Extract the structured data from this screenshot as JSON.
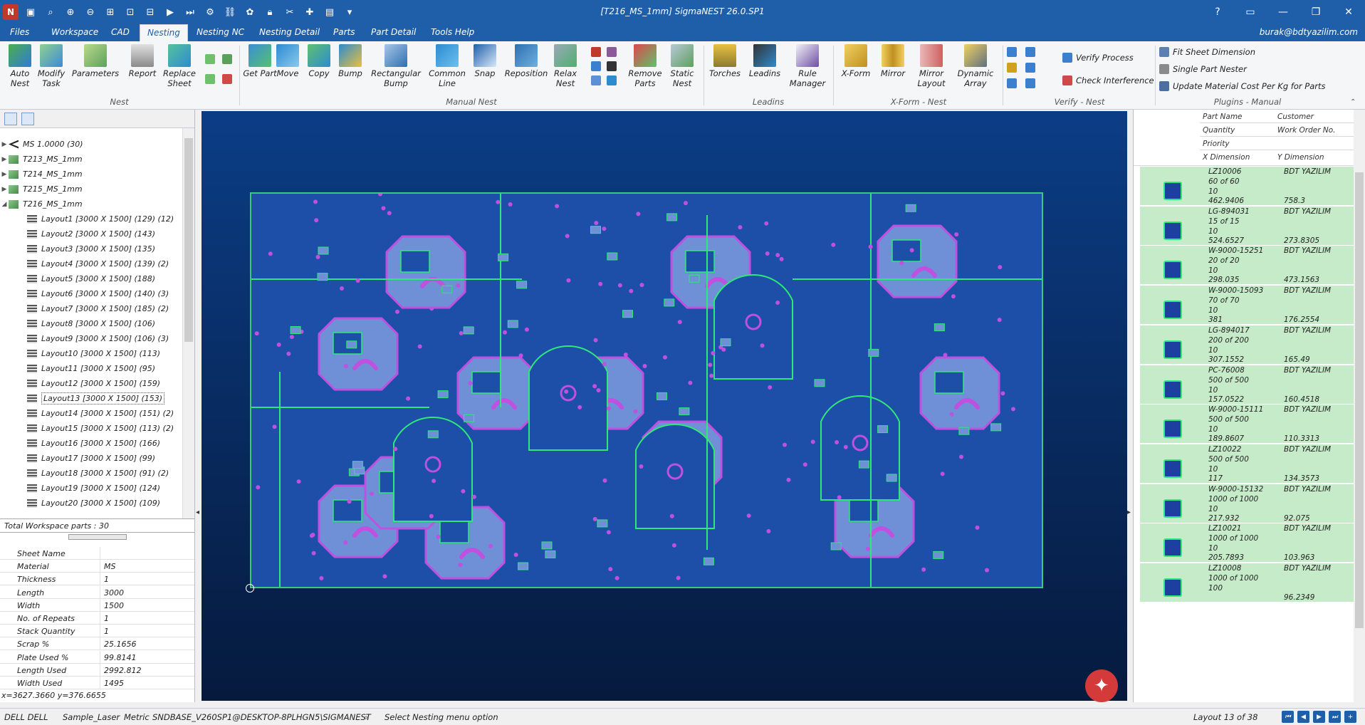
{
  "window": {
    "title": "[T216_MS_1mm]  SigmaNEST 26.0.SP1",
    "app_badge": "N"
  },
  "menu": {
    "tabs": [
      "Files",
      "Workspace",
      "CAD",
      "Nesting",
      "Nesting NC",
      "Nesting Detail",
      "Parts",
      "Part Detail",
      "Tools Help"
    ],
    "active_tab": "Nesting",
    "user": "burak@bdtyazilim.com"
  },
  "ribbon": {
    "groups": {
      "nest": "Nest",
      "manual_nest": "Manual Nest",
      "leadins": "Leadins",
      "xform_nest": "X-Form - Nest",
      "verify_nest": "Verify - Nest",
      "plugins_manual": "Plugins - Manual"
    },
    "buttons": {
      "auto_nest": "Auto Nest",
      "modify_task": "Modify Task",
      "parameters": "Parameters",
      "report": "Report",
      "replace_sheet": "Replace Sheet",
      "get_part": "Get Part",
      "move": "Move",
      "copy": "Copy",
      "bump": "Bump",
      "rect_bump": "Rectangular Bump",
      "common_line": "Common Line",
      "snap": "Snap",
      "reposition": "Reposition",
      "relax_nest": "Relax Nest",
      "remove_parts": "Remove Parts",
      "static_nest": "Static Nest",
      "torches": "Torches",
      "leadins": "Leadins",
      "rule_manager": "Rule Manager",
      "xform": "X-Form",
      "mirror": "Mirror",
      "mirror_layout": "Mirror Layout",
      "dynamic_array": "Dynamic Array",
      "verify_process": "Verify Process",
      "check_interference": "Check Interference",
      "fit_sheet_dimension": "Fit Sheet Dimension",
      "single_part_nester": "Single Part Nester",
      "update_material_cost": "Update Material Cost Per Kg for Parts"
    }
  },
  "tree": {
    "materials": [
      "MS 1.0000 (30)",
      "T213_MS_1mm",
      "T214_MS_1mm",
      "T215_MS_1mm",
      "T216_MS_1mm"
    ],
    "layouts": [
      "Layout1 [3000 X 1500]  (129) (12)",
      "Layout2 [3000 X 1500]  (143)",
      "Layout3 [3000 X 1500]  (135)",
      "Layout4 [3000 X 1500]  (139) (2)",
      "Layout5 [3000 X 1500]  (188)",
      "Layout6 [3000 X 1500]  (140) (3)",
      "Layout7 [3000 X 1500]  (185) (2)",
      "Layout8 [3000 X 1500]  (106)",
      "Layout9 [3000 X 1500]  (106) (3)",
      "Layout10 [3000 X 1500]  (113)",
      "Layout11 [3000 X 1500]  (95)",
      "Layout12 [3000 X 1500]  (159)",
      "Layout13 [3000 X 1500]  (153)",
      "Layout14 [3000 X 1500]  (151) (2)",
      "Layout15 [3000 X 1500]  (113) (2)",
      "Layout16 [3000 X 1500]  (166)",
      "Layout17 [3000 X 1500]  (99)",
      "Layout18 [3000 X 1500]  (91) (2)",
      "Layout19 [3000 X 1500]  (124)",
      "Layout20 [3000 X 1500]  (109)"
    ],
    "selected_layout": "Layout13 [3000 X 1500]  (153)",
    "total_parts": "Total Workspace parts : 30"
  },
  "properties": [
    {
      "k": "Sheet Name",
      "v": ""
    },
    {
      "k": "Material",
      "v": "MS"
    },
    {
      "k": "Thickness",
      "v": "1"
    },
    {
      "k": "Length",
      "v": "3000"
    },
    {
      "k": "Width",
      "v": "1500"
    },
    {
      "k": "No. of Repeats",
      "v": "1"
    },
    {
      "k": "Stack Quantity",
      "v": "1"
    },
    {
      "k": "Scrap %",
      "v": "25.1656"
    },
    {
      "k": "Plate Used %",
      "v": "99.8141"
    },
    {
      "k": "Length Used",
      "v": "2992.812"
    },
    {
      "k": "Width Used",
      "v": "1495"
    }
  ],
  "coords": "x=3627.3660 y=376.6655",
  "parts_panel": {
    "headers": {
      "part_name": "Part Name",
      "customer": "Customer",
      "quantity": "Quantity",
      "work_order": "Work Order No.",
      "priority": "Priority",
      "x_dim": "X Dimension",
      "y_dim": "Y Dimension"
    },
    "parts": [
      {
        "name": "LZ10006",
        "customer": "BDT YAZILIM",
        "qty": "60 of 60",
        "priority": "10",
        "x": "462.9406",
        "y": "758.3"
      },
      {
        "name": "LG-894031",
        "customer": "BDT YAZILIM",
        "qty": "15 of 15",
        "priority": "10",
        "x": "524.6527",
        "y": "273.8305"
      },
      {
        "name": "W-9000-15251",
        "customer": "BDT YAZILIM",
        "qty": "20 of 20",
        "priority": "10",
        "x": "298.035",
        "y": "473.1563"
      },
      {
        "name": "W-9000-15093",
        "customer": "BDT YAZILIM",
        "qty": "70 of 70",
        "priority": "10",
        "x": "381",
        "y": "176.2554"
      },
      {
        "name": "LG-894017",
        "customer": "BDT YAZILIM",
        "qty": "200 of 200",
        "priority": "10",
        "x": "307.1552",
        "y": "165.49"
      },
      {
        "name": "PC-76008",
        "customer": "BDT YAZILIM",
        "qty": "500 of 500",
        "priority": "10",
        "x": "157.0522",
        "y": "160.4518"
      },
      {
        "name": "W-9000-15111",
        "customer": "BDT YAZILIM",
        "qty": "500 of 500",
        "priority": "10",
        "x": "189.8607",
        "y": "110.3313"
      },
      {
        "name": "LZ10022",
        "customer": "BDT YAZILIM",
        "qty": "500 of 500",
        "priority": "10",
        "x": "117",
        "y": "134.3573"
      },
      {
        "name": "W-9000-15132",
        "customer": "BDT YAZILIM",
        "qty": "1000 of 1000",
        "priority": "10",
        "x": "217.932",
        "y": "92.075"
      },
      {
        "name": "LZ10021",
        "customer": "BDT YAZILIM",
        "qty": "1000 of 1000",
        "priority": "10",
        "x": "205.7893",
        "y": "103.963"
      },
      {
        "name": "LZ10008",
        "customer": "BDT YAZILIM",
        "qty": "1000 of 1000",
        "priority": "100",
        "x": "",
        "y": "96.2349"
      }
    ]
  },
  "status": {
    "machine": "DELL DELL",
    "laser": "Sample_Laser",
    "units": "Metric",
    "db": "SNDBASE_V260SP1@DESKTOP-8PLHGN5\\SIGMANEST",
    "hint": "Select Nesting menu option",
    "layout_pos": "Layout 13 of 38"
  },
  "colors": {
    "titlebar": "#1f5faa",
    "sheet": "#1d4fa8",
    "sheet_border": "#3cc97c",
    "part_fill": "#6f8fd6",
    "part_outline": "#2ee87a",
    "hole": "#c050e0",
    "part_row_bg": "#c6ebc8"
  }
}
